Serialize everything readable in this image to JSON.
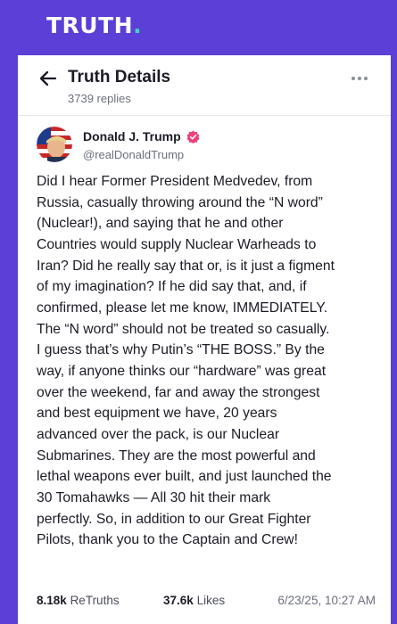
{
  "brand": {
    "name": "TRUTH",
    "dot": "."
  },
  "header": {
    "title": "Truth Details",
    "replies": "3739 replies"
  },
  "post": {
    "author_name": "Donald J. Trump",
    "handle": "@realDonaldTrump",
    "verified": true,
    "lines": [
      "Did I hear Former President Medvedev, from",
      "Russia, casually throwing around the “N word”",
      "(Nuclear!), and saying that he and other",
      "Countries would supply Nuclear Warheads to",
      "Iran? Did he really say that or, is it just a figment",
      "of my imagination? If he did say that, and, if",
      "confirmed, please let me know, IMMEDIATELY.",
      "The “N word” should not be treated so casually.",
      "I guess that’s why Putin’s “THE BOSS.” By the",
      "way, if anyone thinks our “hardware” was great",
      "over the weekend, far and away the strongest",
      "and best equipment we have, 20 years",
      "advanced over the pack, is our Nuclear",
      "Submarines. They are the most powerful and",
      "lethal weapons ever built, and just launched the",
      "30 Tomahawks — All 30 hit their mark",
      "perfectly. So, in addition to our Great Fighter",
      "Pilots, thank you to the Captain and Crew!"
    ],
    "retruths_count": "8.18k",
    "retruths_label": "ReTruths",
    "likes_count": "37.6k",
    "likes_label": "Likes",
    "date": "6/23/25, 10:27 AM"
  },
  "icons": {
    "back": "arrow-left-icon",
    "more": "more-horizontal-icon",
    "verified": "verified-badge-icon"
  },
  "colors": {
    "brand_purple": "#5b3fd6",
    "brand_teal": "#3ed6c3",
    "verified_pink": "#ec407a"
  }
}
